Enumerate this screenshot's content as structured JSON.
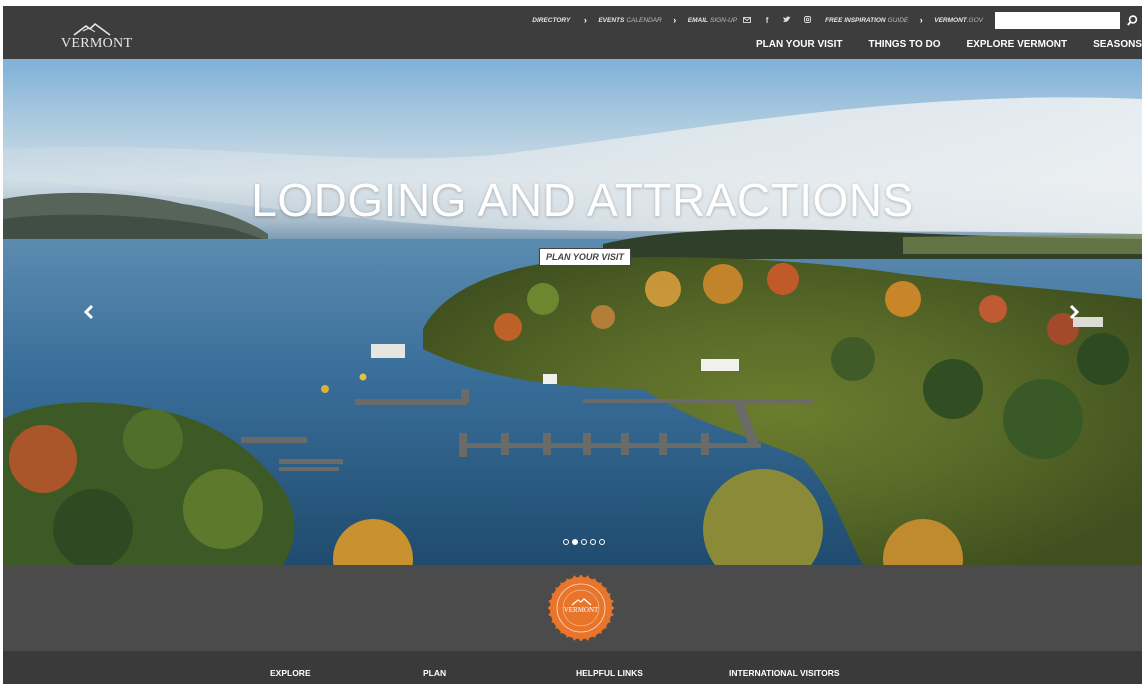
{
  "brand": {
    "logo_text": "VERMONT"
  },
  "utility_nav": {
    "directory": "DIRECTORY",
    "events_bold": "EVENTS",
    "events_light": "CALENDAR",
    "email_bold": "EMAIL",
    "email_light": "SIGN-UP",
    "guide_bold": "FREE INSPIRATION",
    "guide_light": "GUIDE",
    "gov_bold": "VERMONT",
    "gov_light": ".GOV",
    "social": [
      "email-icon",
      "facebook-icon",
      "twitter-icon",
      "instagram-icon"
    ],
    "search_placeholder": ""
  },
  "main_nav": {
    "items": [
      "PLAN YOUR VISIT",
      "THINGS TO DO",
      "EXPLORE VERMONT",
      "SEASONS"
    ]
  },
  "hero": {
    "title": "LODGING AND ATTRACTIONS",
    "cta": "PLAN YOUR VISIT",
    "slides_total": 5,
    "active_slide": 2
  },
  "footer": {
    "columns": [
      "EXPLORE",
      "PLAN",
      "HELPFUL LINKS",
      "INTERNATIONAL VISITORS"
    ]
  },
  "colors": {
    "header_bg": "#3d3d3d",
    "band_bg": "#4b4b4b",
    "footer_bg": "#3a3a3a",
    "seal_orange": "#e8752a"
  }
}
